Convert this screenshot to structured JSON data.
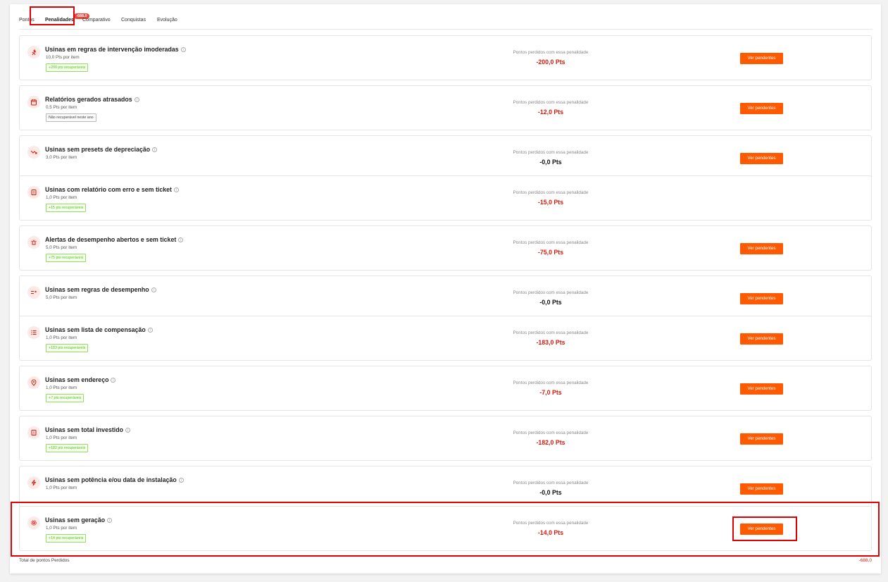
{
  "tabs": [
    {
      "label": "Pontos"
    },
    {
      "label": "Penalidades",
      "badge": "-688,0"
    },
    {
      "label": "Comparativo"
    },
    {
      "label": "Conquistas"
    },
    {
      "label": "Evolução"
    }
  ],
  "active_tab": "Penalidades",
  "penalties": [
    {
      "title": "Usinas em regras de intervenção imoderadas",
      "per_item": "10,0 Pts por item",
      "tag": "+200 pts recuperáveis",
      "tag_type": "green",
      "lost_label": "Pontos perdidos com essa penalidade",
      "lost_value": "-200,0 Pts",
      "value_color": "red",
      "button": "Ver pendentes",
      "icon": "run-icon"
    },
    {
      "title": "Relatórios gerados atrasados",
      "per_item": "0,5 Pts por item",
      "tag": "Não recuperável neste ano",
      "tag_type": "gray",
      "lost_label": "Pontos perdidos com essa penalidade",
      "lost_value": "-12,0 Pts",
      "value_color": "red",
      "button": "Ver pendentes",
      "icon": "calendar-icon"
    },
    {
      "title": "Usinas sem presets de depreciação",
      "per_item": "3,0 Pts por item",
      "tag": "",
      "tag_type": "none",
      "lost_label": "Pontos perdidos com essa penalidade",
      "lost_value": "-0,0 Pts",
      "value_color": "black",
      "button": "Ver pendentes",
      "icon": "trend-down-icon"
    },
    {
      "title": "Usinas com relatório com erro e sem ticket",
      "per_item": "1,0 Pts por item",
      "tag": "+15 pts recuperáveis",
      "tag_type": "green",
      "lost_label": "Pontos perdidos com essa penalidade",
      "lost_value": "-15,0 Pts",
      "value_color": "red",
      "button": "",
      "icon": "report-icon"
    },
    {
      "title": "Alertas de desempenho abertos e sem ticket",
      "per_item": "5,0 Pts por item",
      "tag": "+75 pts recuperáveis",
      "tag_type": "green",
      "lost_label": "Pontos perdidos com essa penalidade",
      "lost_value": "-75,0 Pts",
      "value_color": "red",
      "button": "Ver pendentes",
      "icon": "alarm-icon"
    },
    {
      "title": "Usinas sem regras de desempenho",
      "per_item": "5,0 Pts por item",
      "tag": "",
      "tag_type": "none",
      "lost_label": "Pontos perdidos com essa penalidade",
      "lost_value": "-0,0 Pts",
      "value_color": "black",
      "button": "Ver pendentes",
      "icon": "rules-icon"
    },
    {
      "title": "Usinas sem lista de compensação",
      "per_item": "1,0 Pts por item",
      "tag": "+183 pts recuperáveis",
      "tag_type": "green",
      "lost_label": "Pontos perdidos com essa penalidade",
      "lost_value": "-183,0 Pts",
      "value_color": "red",
      "button": "Ver pendentes",
      "icon": "list-icon"
    },
    {
      "title": "Usinas sem endereço",
      "per_item": "1,0 Pts por item",
      "tag": "+7 pts recuperáveis",
      "tag_type": "green",
      "lost_label": "Pontos perdidos com essa penalidade",
      "lost_value": "-7,0 Pts",
      "value_color": "red",
      "button": "Ver pendentes",
      "icon": "location-pin-icon"
    },
    {
      "title": "Usinas sem total investido",
      "per_item": "1,0 Pts por item",
      "tag": "+182 pts recuperáveis",
      "tag_type": "green",
      "lost_label": "Pontos perdidos com essa penalidade",
      "lost_value": "-182,0 Pts",
      "value_color": "red",
      "button": "Ver pendentes",
      "icon": "money-icon"
    },
    {
      "title": "Usinas sem potência e/ou data de instalação",
      "per_item": "1,0 Pts por item",
      "tag": "",
      "tag_type": "none",
      "lost_label": "Pontos perdidos com essa penalidade",
      "lost_value": "-0,0 Pts",
      "value_color": "black",
      "button": "Ver pendentes",
      "icon": "lightning-icon"
    },
    {
      "title": "Usinas sem geração",
      "per_item": "1,0 Pts por item",
      "tag": "+14 pts recuperáveis",
      "tag_type": "green",
      "lost_label": "Pontos perdidos com essa penalidade",
      "lost_value": "-14,0 Pts",
      "value_color": "red",
      "button": "Ver pendentes",
      "icon": "gear-icon"
    }
  ],
  "footer": {
    "label": "Total de pontos Perdidos",
    "value": "-688,0"
  },
  "colors": {
    "accent": "#ff5a00",
    "loss": "#d81b0c",
    "recoverable": "#52c41a",
    "highlight": "#e00000"
  }
}
